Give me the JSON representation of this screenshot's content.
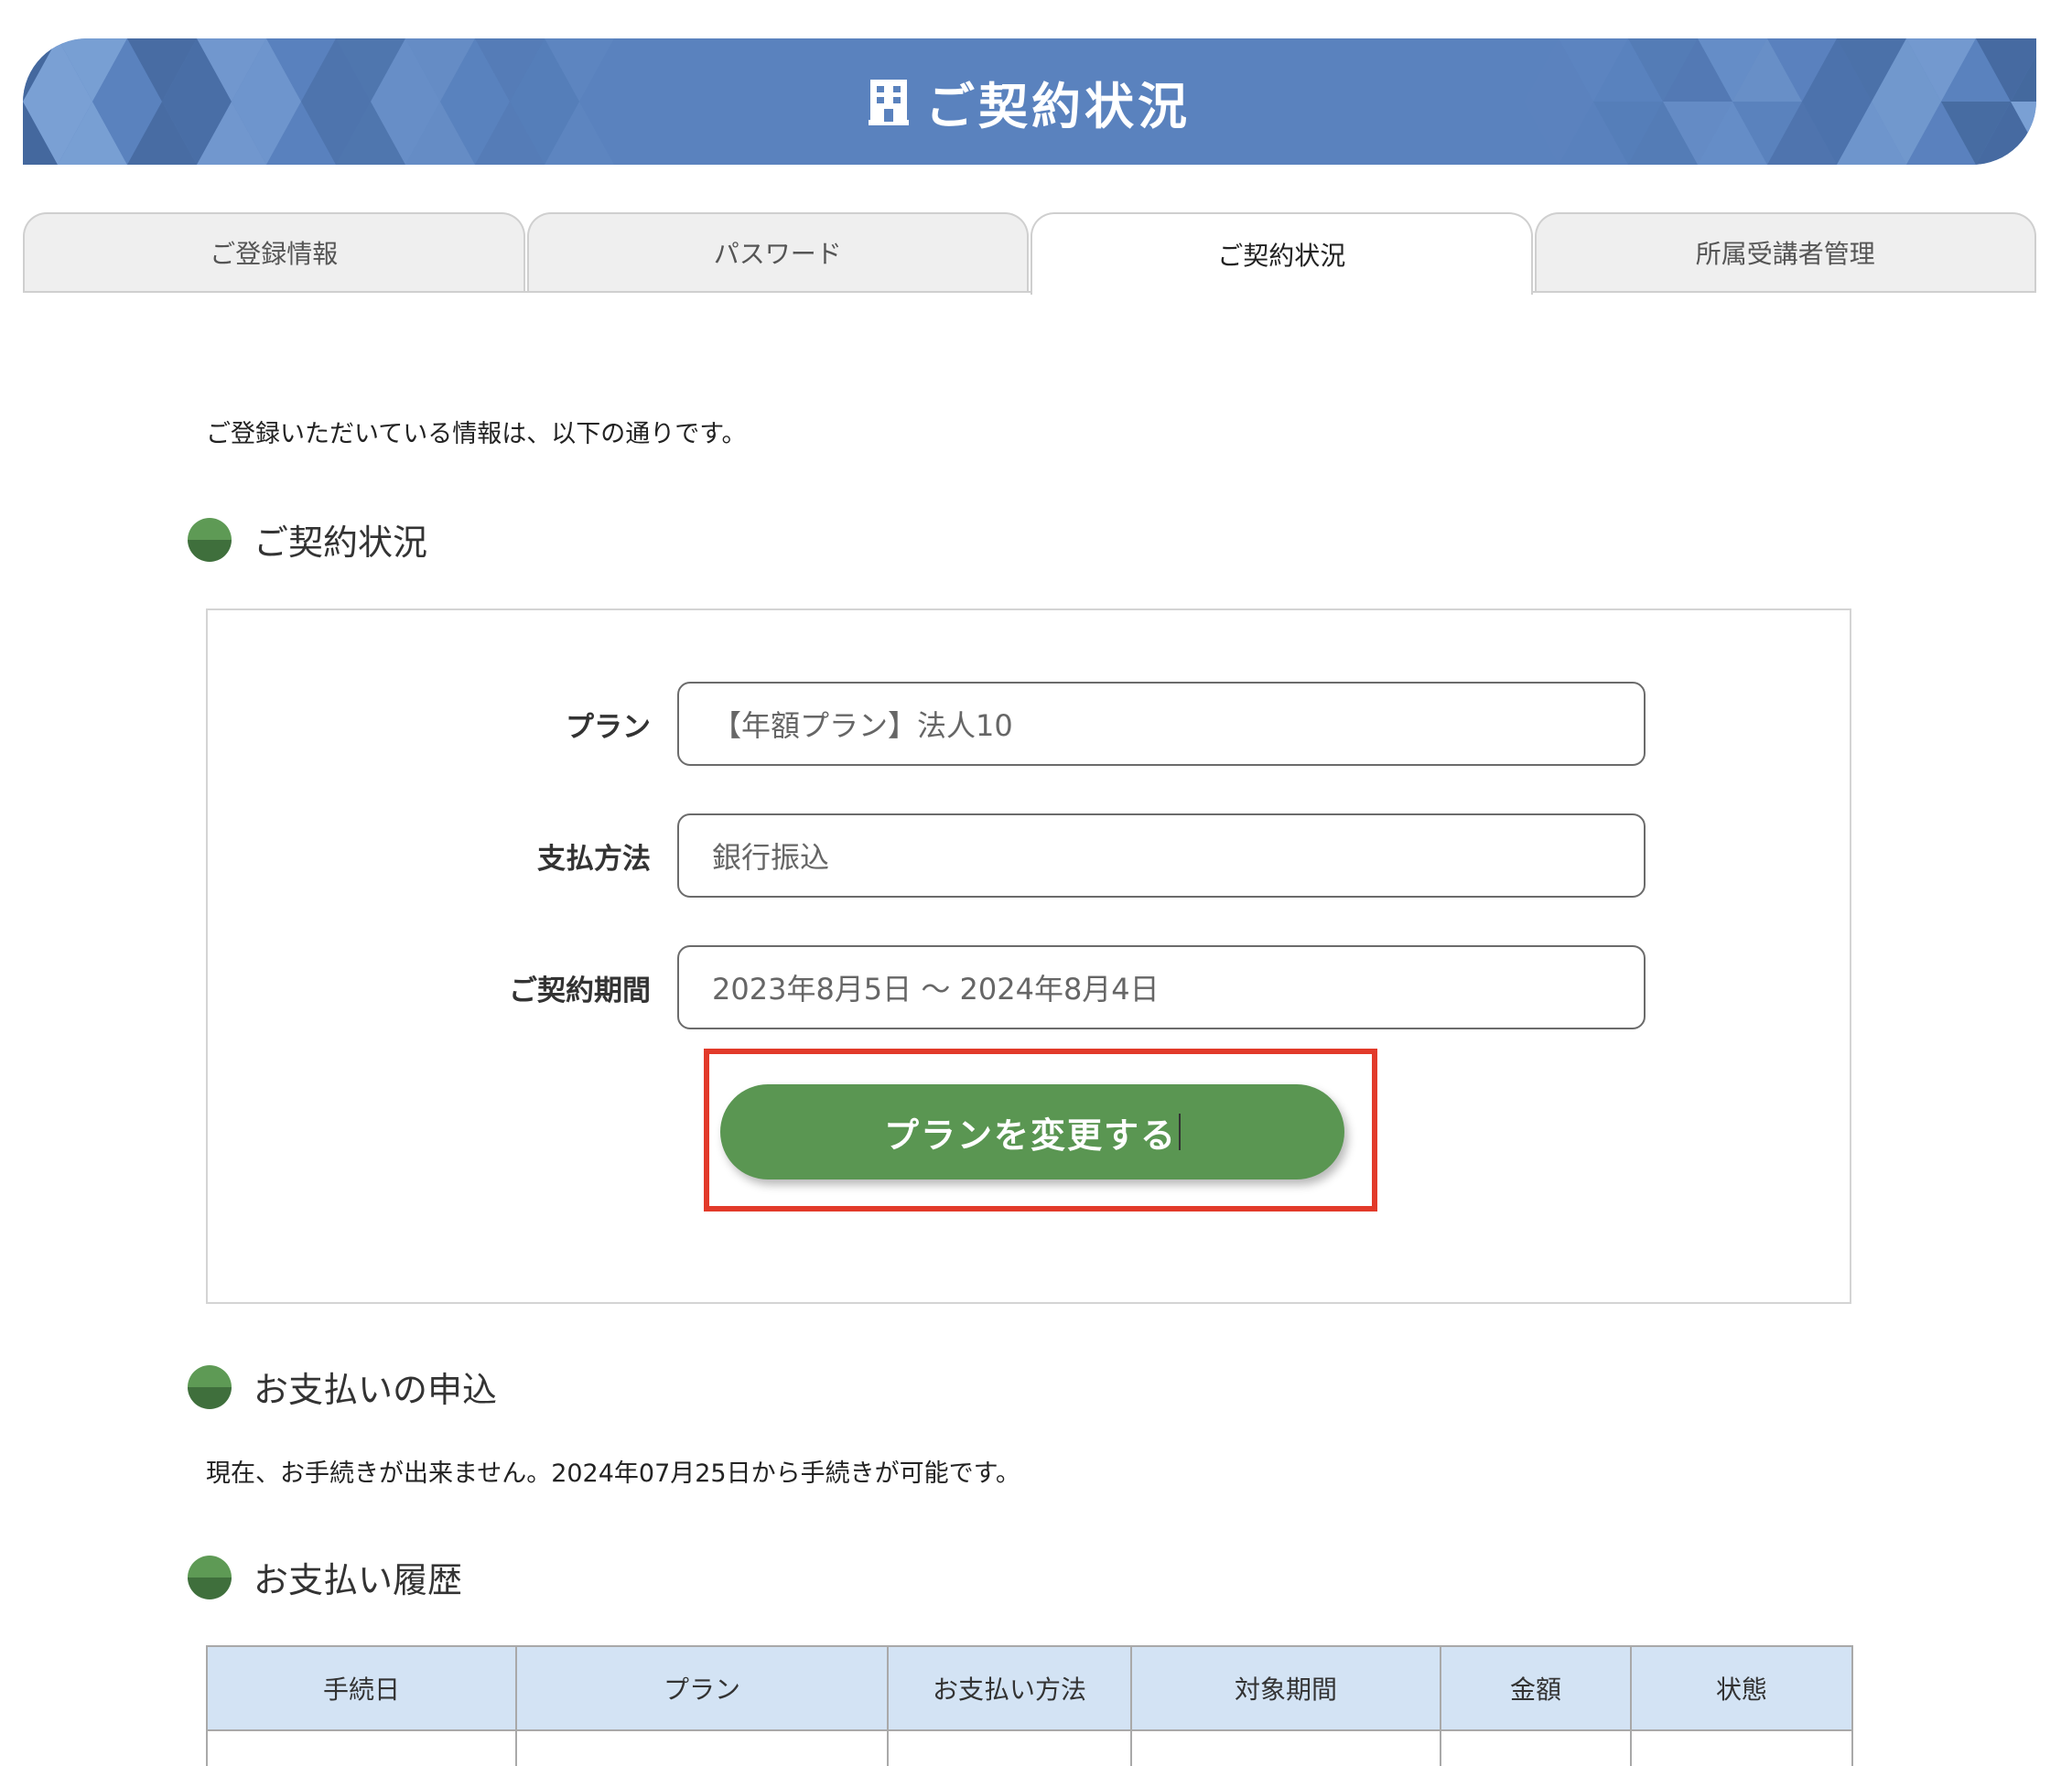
{
  "header": {
    "title": "ご契約状況",
    "icon": "building-icon",
    "colors": {
      "banner": "#5a82be",
      "triangle_dark": "#44689e",
      "triangle_light": "#7aa0d4"
    }
  },
  "tabs": [
    {
      "label": "ご登録情報",
      "active": false
    },
    {
      "label": "パスワード",
      "active": false
    },
    {
      "label": "ご契約状況",
      "active": true
    },
    {
      "label": "所属受講者管理",
      "active": false
    }
  ],
  "intro_text": "ご登録いただいている情報は、以下の通りです。",
  "contract_section": {
    "heading": "ご契約状況",
    "fields": [
      {
        "label": "プラン",
        "value": "【年額プラン】法人10"
      },
      {
        "label": "支払方法",
        "value": "銀行振込"
      },
      {
        "label": "ご契約期間",
        "value": "2023年8月5日 〜 2024年8月4日"
      }
    ],
    "change_plan_button": "プランを変更する",
    "button_color": "#5a9652",
    "highlight_color": "#e23a2a"
  },
  "payment_section": {
    "heading": "お支払いの申込",
    "note": "現在、お手続きが出来ません。2024年07月25日から手続きが可能です。"
  },
  "history_section": {
    "heading": "お支払い履歴",
    "columns": [
      "手続日",
      "プラン",
      "お支払い方法",
      "対象期間",
      "金額",
      "状態"
    ],
    "header_color": "#d3e3f4"
  }
}
